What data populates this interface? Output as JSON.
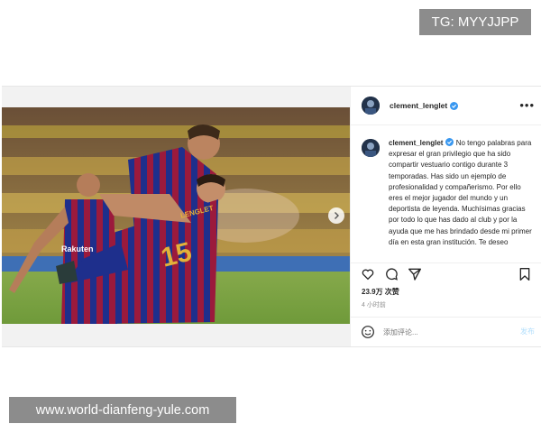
{
  "badge": {
    "text": "TG: MYYJJPP"
  },
  "post": {
    "username": "clement_lenglet",
    "caption_username": "clement_lenglet",
    "caption": "No tengo palabras para expresar el gran privilegio que ha sido compartir vestuario contigo durante 3 temporadas. Has sido un ejemplo de profesionalidad y compañerismo. Por ello eres el mejor jugador del mundo y un deportista de leyenda. Muchísimas gracias por todo lo que has dado al club y por la ayuda que me has brindado desde mi primer día en esta gran institución. Te deseo",
    "photo": {
      "sponsor": "Rakuten",
      "jersey_number": "15",
      "jersey_name": "LENGLET"
    },
    "likes": "23.9万 次赞",
    "time_ago": "4 小时前",
    "comment_placeholder": "添加评论...",
    "post_button": "发布"
  },
  "watermark": {
    "text": "www.world-dianfeng-yule.com"
  },
  "colors": {
    "verified": "#3897f0",
    "badge_bg": "#8c8c8c",
    "post_button": "#b2dffc"
  },
  "icons": [
    "more-options-icon",
    "heart-icon",
    "comment-icon",
    "share-icon",
    "bookmark-icon",
    "emoji-icon",
    "next-arrow-icon",
    "verified-badge-icon"
  ]
}
